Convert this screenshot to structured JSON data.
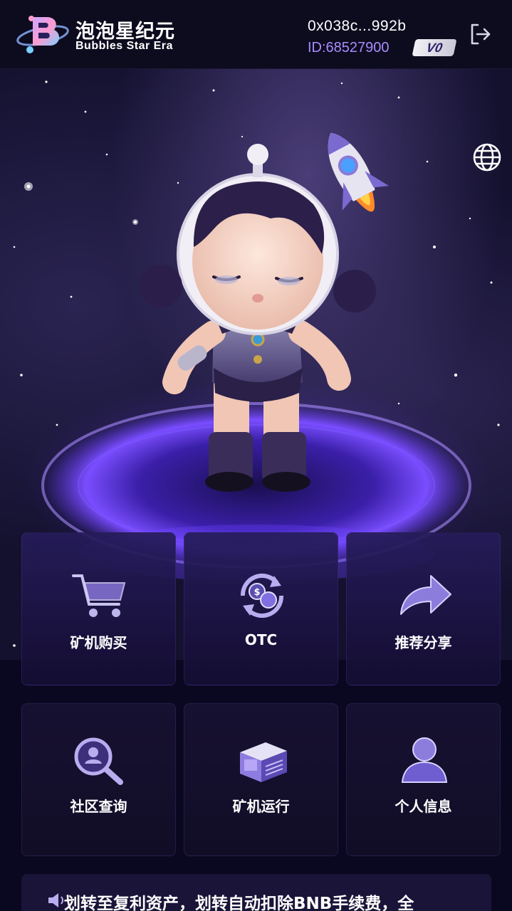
{
  "header": {
    "brand_cn": "泡泡星纪元",
    "brand_en": "Bubbles Star Era",
    "address": "0x038c...992b",
    "user_id": "ID:68527900",
    "level": "V0"
  },
  "menu": [
    {
      "label": "矿机购买",
      "icon": "shopping-cart-icon"
    },
    {
      "label": "OTC",
      "icon": "exchange-icon"
    },
    {
      "label": "推荐分享",
      "icon": "share-arrow-icon"
    },
    {
      "label": "社区查询",
      "icon": "user-search-icon"
    },
    {
      "label": "矿机运行",
      "icon": "mining-machine-icon"
    },
    {
      "label": "个人信息",
      "icon": "user-profile-icon"
    }
  ],
  "notice": {
    "icon": "speaker-icon",
    "text": "划转至复利资产，划转自动扣除BNB手续费，全"
  },
  "colors": {
    "accent": "#a98cff",
    "background": "#0a0820",
    "tile": "#1e1648"
  }
}
